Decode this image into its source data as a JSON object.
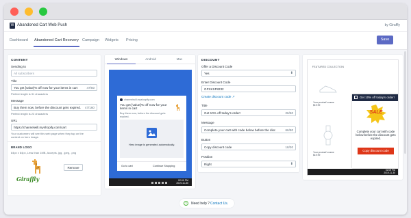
{
  "app": {
    "title": "Abandoned Cart Web Push",
    "byline": "by Giraffly",
    "logo_letter": "W"
  },
  "colors": {
    "accent": "#5c6ac4",
    "danger": "#de3618",
    "dark": "#1f2a44",
    "push_blue": "#2e6bd6"
  },
  "nav": {
    "tabs": [
      "Dashboard",
      "Abandoned Cart Recovery",
      "Campaign",
      "Widgets",
      "Pricing"
    ],
    "active": "Abandoned Cart Recovery",
    "save_label": "Save"
  },
  "content": {
    "heading": "CONTENT",
    "sending_to_label": "Sending to",
    "sending_to_value": "All subscribers",
    "title_label": "Title",
    "title_value": "You get [value]% off now for your items in cart",
    "title_count": "47/50",
    "title_help": "Perfect length is 31 characters",
    "message_label": "Message",
    "message_value": "Buy them now, before the discount gets expired.",
    "message_count": "47/160",
    "message_help": "Perfect length is 23 characters",
    "url_label": "URL",
    "url_value": "https://channelwill.myshopify.com/cart",
    "url_help_1": "Your customers will see this web page when they tap on the",
    "url_help_2": "content on hero image.",
    "brand_logo_heading": "BRAND LOGO",
    "brand_logo_help": "84px x 84px, Less than 1MB, Accepts .jpg, .jpeg, .png",
    "logo_text": "Giraffly",
    "remove_label": "Remove"
  },
  "preview": {
    "tabs": [
      "Windows",
      "Android",
      "Mac"
    ],
    "active": "Windows",
    "domain": "channelwill.myshopify.com",
    "notif_title": "You get [value]% off now for your items in cart",
    "notif_message": "Buy them now, before the discount gets expired.",
    "hero_text": "Hero image is generated automatically.",
    "action_1": "Go to cart",
    "action_2": "Continue Shopping",
    "time": "02:09 PM",
    "date": "2019-11-30"
  },
  "discount": {
    "heading": "DISCOUNT",
    "offer_label": "Offer a Discount Code",
    "offer_value": "Yes",
    "code_label": "Enter Discount Code",
    "code_value": "GFXKSF8232",
    "create_link": "Create discount code",
    "title_label": "Title",
    "title_value": "Get 10% off today's order!",
    "title_count": "26/50",
    "message_label": "Message",
    "message_value": "Complete your cart with code below before the disc",
    "message_count": "66/80",
    "button_label": "Button",
    "button_value": "Copy discount code",
    "button_count": "18/30",
    "position_label": "Position",
    "position_value": "Right"
  },
  "store_preview": {
    "featured": "FEATURED COLLECTION",
    "product_name": "Your product's name",
    "product_price": "$19.99",
    "popup_title": "Get 10% off today's order!",
    "popup_message": "Complete your cart with code below before the discount gets expired.",
    "sale_text": "SALE",
    "popup_button": "Copy discount code",
    "time": "02:09 PM",
    "date": "2019-11-30"
  },
  "footer": {
    "help_text": "Need help ?",
    "contact_link": "Contact Us."
  }
}
